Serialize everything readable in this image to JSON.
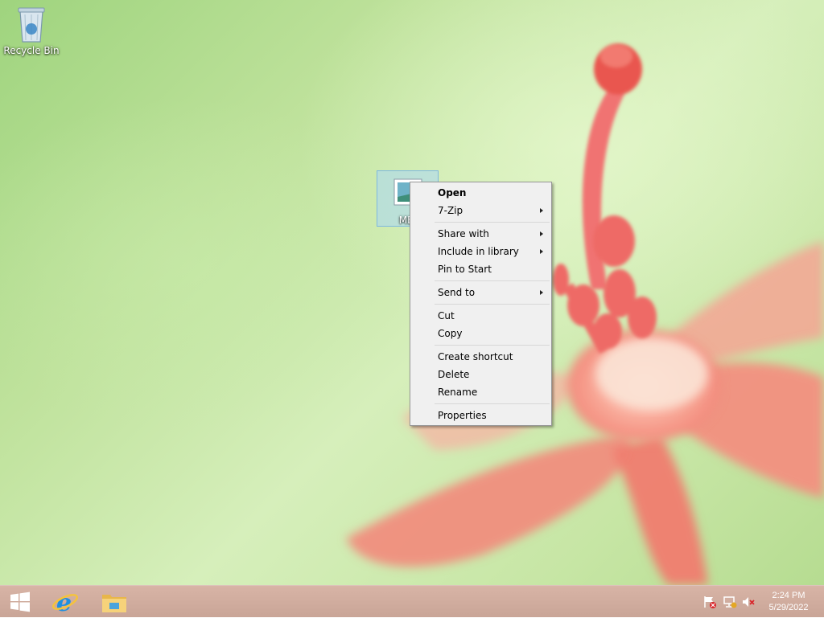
{
  "desktop": {
    "icons": [
      {
        "label": "Recycle Bin"
      },
      {
        "label": "MEI"
      }
    ]
  },
  "context_menu": {
    "groups": [
      [
        {
          "label": "Open",
          "bold": true
        },
        {
          "label": "7-Zip",
          "submenu": true
        }
      ],
      [
        {
          "label": "Share with",
          "submenu": true
        },
        {
          "label": "Include in library",
          "submenu": true
        },
        {
          "label": "Pin to Start"
        }
      ],
      [
        {
          "label": "Send to",
          "submenu": true
        }
      ],
      [
        {
          "label": "Cut"
        },
        {
          "label": "Copy"
        }
      ],
      [
        {
          "label": "Create shortcut"
        },
        {
          "label": "Delete"
        },
        {
          "label": "Rename"
        }
      ],
      [
        {
          "label": "Properties"
        }
      ]
    ]
  },
  "taskbar": {
    "pinned": [
      {
        "icon": "windows-start-icon"
      },
      {
        "icon": "internet-explorer-icon"
      },
      {
        "icon": "file-explorer-icon"
      }
    ],
    "tray": [
      {
        "icon": "action-center-flag-icon"
      },
      {
        "icon": "network-icon"
      },
      {
        "icon": "volume-muted-icon"
      }
    ],
    "clock": {
      "time": "2:24 PM",
      "date": "5/29/2022"
    }
  },
  "colors": {
    "taskbar": "#cfac9e",
    "menu_bg": "#f0f0f0",
    "selection": "#aad7f5"
  }
}
